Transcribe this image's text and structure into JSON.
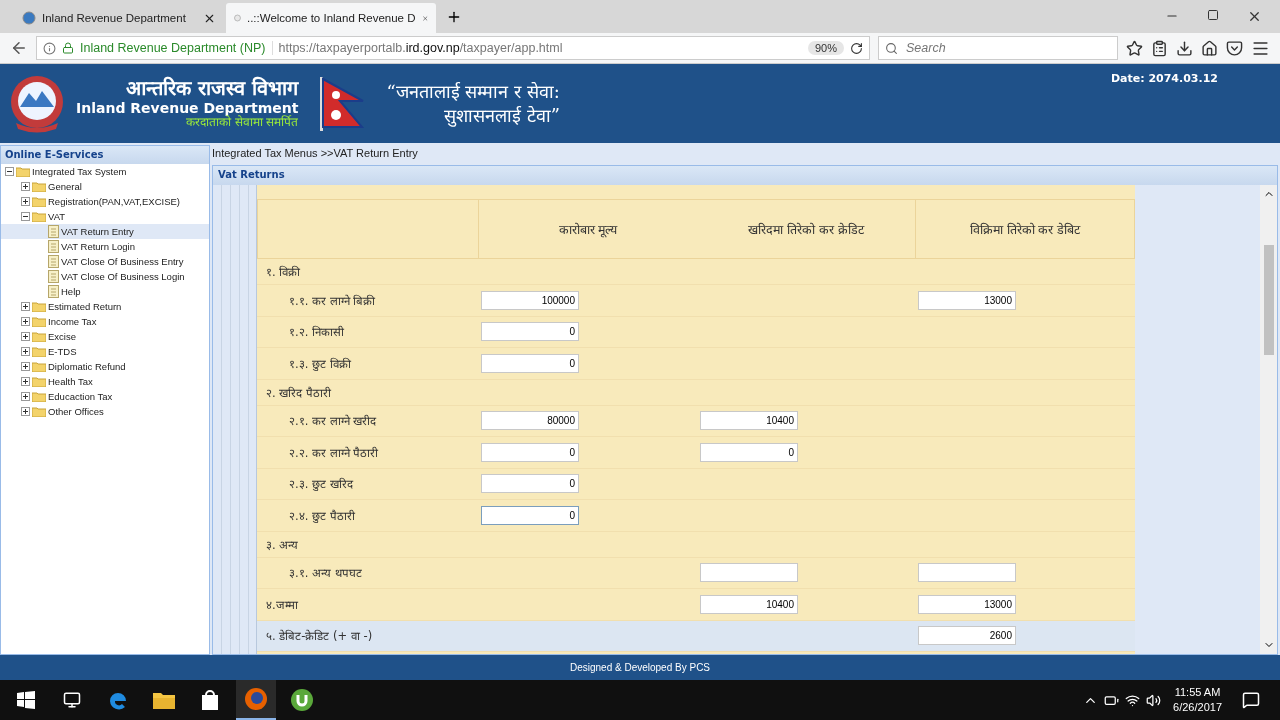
{
  "browser": {
    "tabs": [
      {
        "title": "Inland Revenue Department",
        "selected": false
      },
      {
        "title": "..::Welcome to Inland Revenue D",
        "selected": true
      }
    ],
    "identity": "Inland Revenue Department (NP)",
    "url_prefix": "https://taxpayerportalb.",
    "url_domain": "ird.gov.np",
    "url_path": "/taxpayer/app.html",
    "zoom": "90%",
    "search": {
      "placeholder": "Search"
    }
  },
  "header": {
    "title_np": "आन्तरिक राजस्व विभाग",
    "title_en": "Inland Revenue Department",
    "tagline": "करदाताको सेवामा समर्पित",
    "slogan_1": "“जनतालाई सम्मान र सेवा:",
    "slogan_2": "सुशासनलाई टेवा”",
    "date": "Date: 2074.03.12"
  },
  "sidebar": {
    "title": "Online E-Services",
    "items": [
      {
        "label": "Integrated Tax System",
        "kind": "folder",
        "expanded": true,
        "selected": false,
        "children": [
          {
            "label": "General",
            "kind": "folder",
            "expanded": false,
            "selected": false
          },
          {
            "label": "Registration(PAN,VAT,EXCISE)",
            "kind": "folder",
            "expanded": false,
            "selected": false
          },
          {
            "label": "VAT",
            "kind": "folder",
            "expanded": true,
            "selected": false,
            "children": [
              {
                "label": "VAT Return Entry",
                "kind": "page",
                "selected": true
              },
              {
                "label": "VAT Return Login",
                "kind": "page",
                "selected": false
              },
              {
                "label": "VAT Close Of Business Entry",
                "kind": "page",
                "selected": false
              },
              {
                "label": "VAT Close Of Business Login",
                "kind": "page",
                "selected": false
              },
              {
                "label": "Help",
                "kind": "page",
                "selected": false
              }
            ]
          },
          {
            "label": "Estimated Return",
            "kind": "folder",
            "expanded": false,
            "selected": false
          },
          {
            "label": "Income Tax",
            "kind": "folder",
            "expanded": false,
            "selected": false
          },
          {
            "label": "Excise",
            "kind": "folder",
            "expanded": false,
            "selected": false
          },
          {
            "label": "E-TDS",
            "kind": "folder",
            "expanded": false,
            "selected": false
          },
          {
            "label": "Diplomatic Refund",
            "kind": "folder",
            "expanded": false,
            "selected": false
          },
          {
            "label": "Health Tax",
            "kind": "folder",
            "expanded": false,
            "selected": false
          },
          {
            "label": "Educaction Tax",
            "kind": "folder",
            "expanded": false,
            "selected": false
          },
          {
            "label": "Other Offices",
            "kind": "folder",
            "expanded": false,
            "selected": false
          }
        ]
      }
    ]
  },
  "breadcrumb": "Integrated Tax Menus >>VAT Return Entry",
  "panel": {
    "title": "Vat Returns",
    "columns": [
      "कारोबार मूल्य",
      "खरिदमा तिरेको कर क्रेडिट",
      "विक्रिमा तिरेको कर डेबिट"
    ],
    "rows": [
      {
        "kind": "section",
        "label": "१. विक्री"
      },
      {
        "kind": "item",
        "label": "१.१. कर लाग्ने बिक्री",
        "cells": [
          {
            "kind": "input",
            "value": "100000"
          },
          {
            "kind": "none"
          },
          {
            "kind": "input",
            "value": "13000"
          }
        ]
      },
      {
        "kind": "item",
        "label": "१.२. निकासी",
        "cells": [
          {
            "kind": "input",
            "value": "0"
          },
          {
            "kind": "none"
          },
          {
            "kind": "none"
          }
        ]
      },
      {
        "kind": "item",
        "label": "१.३. छुट विक्री",
        "cells": [
          {
            "kind": "input",
            "value": "0"
          },
          {
            "kind": "none"
          },
          {
            "kind": "none"
          }
        ]
      },
      {
        "kind": "section",
        "label": "२. खरिद पैठारी"
      },
      {
        "kind": "item",
        "label": "२.१. कर लाग्ने खरीद",
        "cells": [
          {
            "kind": "input",
            "value": "80000"
          },
          {
            "kind": "input",
            "value": "10400"
          },
          {
            "kind": "none"
          }
        ]
      },
      {
        "kind": "item",
        "label": "२.२. कर लाग्ने पैठारी",
        "cells": [
          {
            "kind": "input",
            "value": "0"
          },
          {
            "kind": "input",
            "value": "0"
          },
          {
            "kind": "none"
          }
        ]
      },
      {
        "kind": "item",
        "label": "२.३. छुट खरिद",
        "cells": [
          {
            "kind": "input",
            "value": "0"
          },
          {
            "kind": "none"
          },
          {
            "kind": "none"
          }
        ]
      },
      {
        "kind": "item",
        "label": "२.४. छुट पैठारी",
        "cells": [
          {
            "kind": "input",
            "value": "0",
            "focused": true
          },
          {
            "kind": "none"
          },
          {
            "kind": "none"
          }
        ]
      },
      {
        "kind": "section",
        "label": "३. अन्य"
      },
      {
        "kind": "item",
        "label": "३.१. अन्य थपघट",
        "cells": [
          {
            "kind": "none"
          },
          {
            "kind": "input"
          },
          {
            "kind": "input"
          }
        ]
      },
      {
        "kind": "total",
        "label": "४.जम्मा",
        "cells": [
          {
            "kind": "none"
          },
          {
            "kind": "input",
            "value": "10400"
          },
          {
            "kind": "input",
            "value": "13000"
          }
        ]
      },
      {
        "kind": "highlight",
        "label": "५. डेबिट-क्रेडिट (+ वा -)",
        "cells": [
          {
            "kind": "none"
          },
          {
            "kind": "none"
          },
          {
            "kind": "input",
            "value": "2600"
          }
        ]
      }
    ]
  },
  "footer": "Designed & Developed By PCS",
  "taskbar": {
    "time": "11:55 AM",
    "date": "6/26/2017"
  }
}
